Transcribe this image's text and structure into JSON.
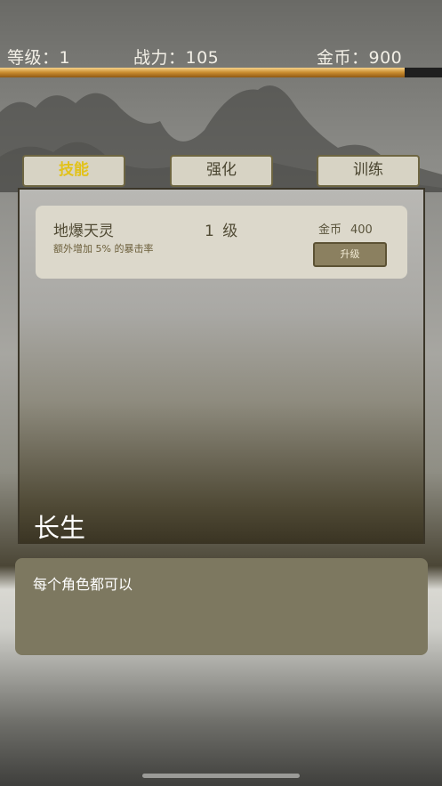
{
  "status": {
    "level_text": "等级：1",
    "power_text": "战力：105",
    "gold_text": "金币：900",
    "progress_fraction": 0.915
  },
  "tabs": [
    {
      "label": "技能",
      "active": true
    },
    {
      "label": "强化",
      "active": false
    },
    {
      "label": "训练",
      "active": false
    }
  ],
  "skill": {
    "name": "地爆天灵",
    "level": "1 级",
    "description": "额外增加 5% 的暴击率",
    "cost_label": "金币",
    "cost_amount": "400",
    "upgrade_label": "升级"
  },
  "character": {
    "name": "长生",
    "description": "每个角色都可以"
  },
  "colors": {
    "tab_active_text": "#e2c21a",
    "progress_fill": "#c88b2e",
    "card_bg": "#dcd8cb"
  }
}
